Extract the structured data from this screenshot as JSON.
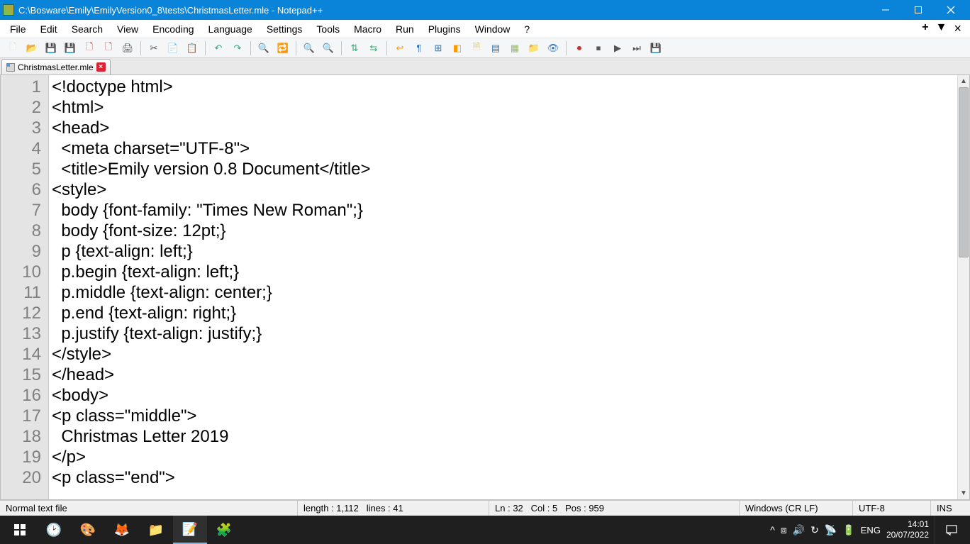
{
  "titlebar": {
    "path": "C:\\Bosware\\Emily\\EmilyVersion0_8\\tests\\ChristmasLetter.mle - Notepad++"
  },
  "menu": {
    "items": [
      "File",
      "Edit",
      "Search",
      "View",
      "Encoding",
      "Language",
      "Settings",
      "Tools",
      "Macro",
      "Run",
      "Plugins",
      "Window",
      "?"
    ]
  },
  "tab": {
    "name": "ChristmasLetter.mle"
  },
  "code": {
    "lines": [
      "<!doctype html>",
      "<html>",
      "<head>",
      "  <meta charset=\"UTF-8\">",
      "  <title>Emily version 0.8 Document</title>",
      "<style>",
      "  body {font-family: \"Times New Roman\";}",
      "  body {font-size: 12pt;}",
      "  p {text-align: left;}",
      "  p.begin {text-align: left;}",
      "  p.middle {text-align: center;}",
      "  p.end {text-align: right;}",
      "  p.justify {text-align: justify;}",
      "</style>",
      "</head>",
      "<body>",
      "<p class=\"middle\">",
      "  Christmas Letter 2019",
      "</p>",
      "<p class=\"end\">"
    ],
    "start_line": 1
  },
  "status": {
    "filetype": "Normal text file",
    "length_label": "length :",
    "length_value": "1,112",
    "lines_label": "lines :",
    "lines_value": "41",
    "ln_label": "Ln :",
    "ln_value": "32",
    "col_label": "Col :",
    "col_value": "5",
    "pos_label": "Pos :",
    "pos_value": "959",
    "eol": "Windows (CR LF)",
    "encoding": "UTF-8",
    "mode": "INS"
  },
  "taskbar": {
    "lang": "ENG",
    "time": "14:01",
    "date": "20/07/2022"
  }
}
